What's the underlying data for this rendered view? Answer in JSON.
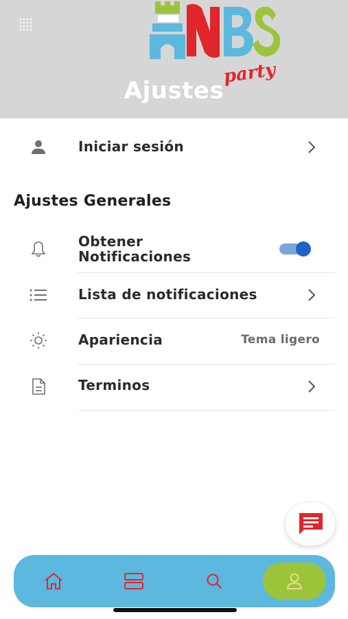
{
  "header": {
    "title": "Ajustes",
    "logo_text": "NBS",
    "logo_subtext": "party",
    "menu_icon": "grid-dots-icon",
    "background_color": "#d6d6d6"
  },
  "login": {
    "label": "Iniciar sesión",
    "icon": "person-icon"
  },
  "general": {
    "title": "Ajustes Generales",
    "notifications": {
      "label_line1": "Obtener",
      "label_line2": "Notificaciones",
      "icon": "bell-icon",
      "enabled": true
    },
    "notification_list": {
      "label": "Lista de notificaciones",
      "icon": "list-icon"
    },
    "appearance": {
      "label": "Apariencia",
      "value": "Tema ligero",
      "icon": "sun-icon"
    },
    "terms": {
      "label": "Terminos",
      "icon": "document-icon"
    }
  },
  "fab": {
    "icon": "chat-icon",
    "color": "#e0262b"
  },
  "bottom_nav": {
    "items": [
      {
        "name": "home",
        "icon": "home-icon",
        "active": false
      },
      {
        "name": "list",
        "icon": "list-view-icon",
        "active": false
      },
      {
        "name": "search",
        "icon": "search-icon",
        "active": false
      },
      {
        "name": "profile",
        "icon": "profile-icon",
        "active": true
      }
    ],
    "bar_color": "#5cb8de",
    "active_color": "#9cc43a",
    "icon_color": "#e0262b"
  }
}
